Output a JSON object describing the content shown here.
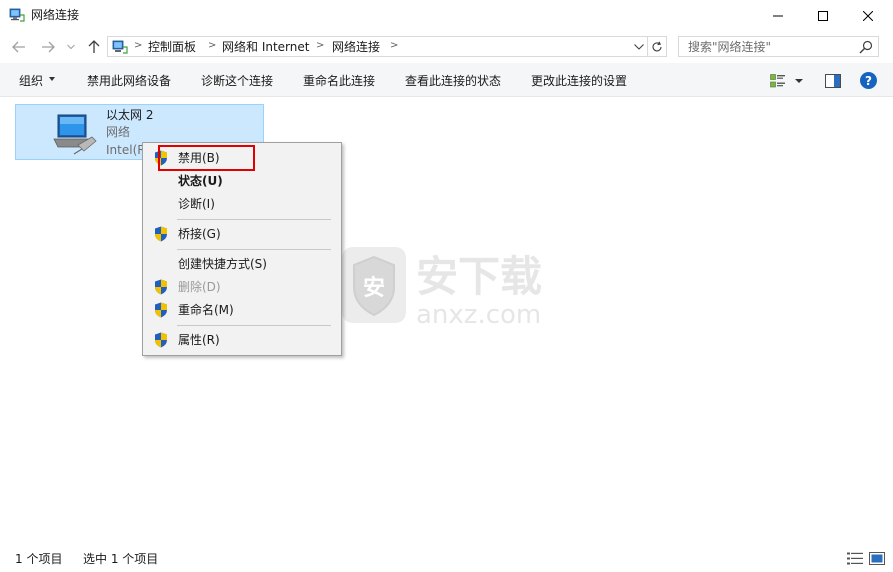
{
  "window": {
    "title": "网络连接"
  },
  "address_bar": {
    "breadcrumbs": [
      "控制面板",
      "网络和 Internet",
      "网络连接"
    ],
    "search_placeholder": "搜索\"网络连接\""
  },
  "command_bar": {
    "organize": "组织",
    "disable_device": "禁用此网络设备",
    "diagnose": "诊断这个连接",
    "rename": "重命名此连接",
    "view_status": "查看此连接的状态",
    "change_settings": "更改此连接的设置",
    "help": "?"
  },
  "connection": {
    "name": "以太网 2",
    "type": "网络",
    "device": "Intel(R"
  },
  "context_menu": {
    "items": [
      {
        "label": "禁用(B)",
        "shield": true,
        "bold": false,
        "disabled": false
      },
      {
        "label": "状态(U)",
        "shield": false,
        "bold": true,
        "disabled": false
      },
      {
        "label": "诊断(I)",
        "shield": false,
        "bold": false,
        "disabled": false
      },
      {
        "label": "桥接(G)",
        "shield": true,
        "bold": false,
        "disabled": false
      },
      {
        "label": "创建快捷方式(S)",
        "shield": false,
        "bold": false,
        "disabled": false
      },
      {
        "label": "删除(D)",
        "shield": true,
        "bold": false,
        "disabled": true
      },
      {
        "label": "重命名(M)",
        "shield": true,
        "bold": false,
        "disabled": false
      },
      {
        "label": "属性(R)",
        "shield": true,
        "bold": false,
        "disabled": false
      }
    ]
  },
  "watermark": {
    "text_cn": "安下载",
    "text_en": "anxz.com",
    "badge_char": "安"
  },
  "status_bar": {
    "item_count": "1 个项目",
    "selected": "选中 1 个项目"
  },
  "colors": {
    "accent_selection": "#cce8ff",
    "selection_border": "#99d1ff",
    "highlight_box": "#e00000",
    "help_blue": "#1565c0"
  }
}
